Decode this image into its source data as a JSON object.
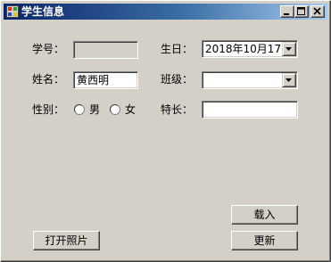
{
  "window": {
    "title": "学生信息"
  },
  "form": {
    "id": {
      "label": "学号：",
      "value": ""
    },
    "birthday": {
      "label": "生日：",
      "value": "2018年10月17日"
    },
    "name": {
      "label": "姓名：",
      "value": "黄西明"
    },
    "class": {
      "label": "班级：",
      "value": ""
    },
    "gender": {
      "label": "性别：",
      "options": [
        {
          "label": "男",
          "selected": false
        },
        {
          "label": "女",
          "selected": false
        }
      ]
    },
    "specialty": {
      "label": "特长：",
      "value": ""
    }
  },
  "buttons": {
    "open_photo": "打开照片",
    "load": "载入",
    "update": "更新"
  },
  "icons": {
    "app": "app-window-icon",
    "minimize": "minimize-icon",
    "maximize": "maximize-icon",
    "close": "close-icon",
    "dropdown": "chevron-down-icon"
  },
  "colors": {
    "titlebar_start": "#0a246a",
    "titlebar_end": "#a6caf0",
    "face": "#d4d0c8"
  }
}
